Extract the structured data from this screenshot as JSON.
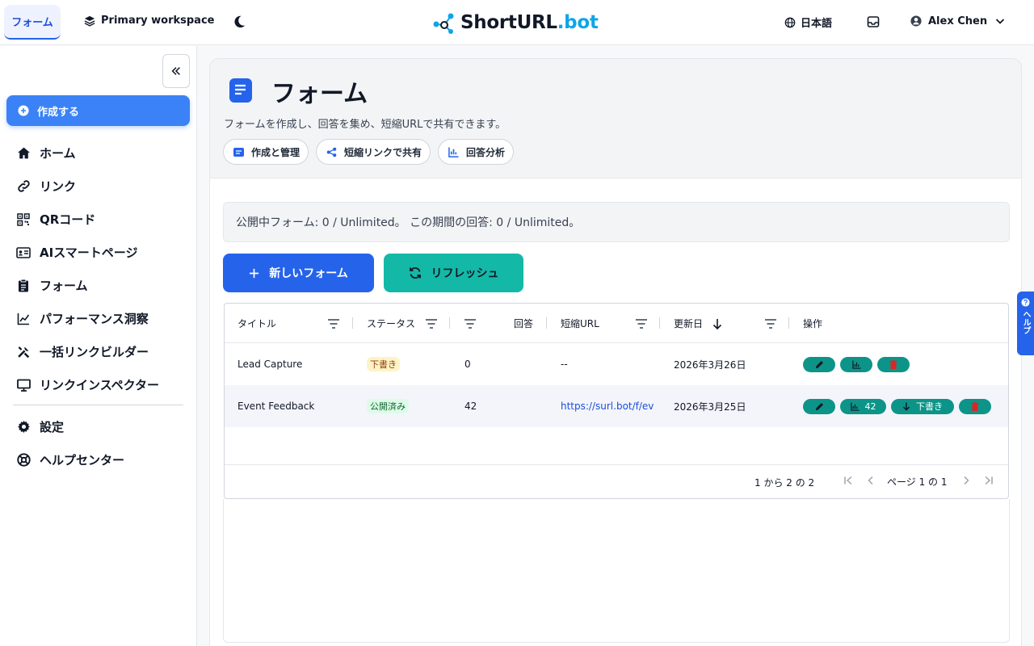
{
  "topbar": {
    "tab_label": "フォーム",
    "workspace": "Primary workspace",
    "logo_main": "ShortURL",
    "logo_suffix": ".bot",
    "language": "日本語",
    "user_name": "Alex Chen"
  },
  "sidebar": {
    "create_label": "作成する",
    "items": [
      {
        "label": "ホーム",
        "icon": "home-icon"
      },
      {
        "label": "リンク",
        "icon": "link-icon"
      },
      {
        "label": "QRコード",
        "icon": "qr-code-icon"
      },
      {
        "label": "AIスマートページ",
        "icon": "id-card-icon"
      },
      {
        "label": "フォーム",
        "icon": "clipboard-icon"
      },
      {
        "label": "パフォーマンス洞察",
        "icon": "chart-line-icon"
      },
      {
        "label": "一括リンクビルダー",
        "icon": "tools-icon"
      },
      {
        "label": "リンクインスペクター",
        "icon": "monitor-icon"
      }
    ],
    "bottom_items": [
      {
        "label": "設定",
        "icon": "gear-icon"
      },
      {
        "label": "ヘルプセンター",
        "icon": "lifebuoy-icon"
      }
    ]
  },
  "header": {
    "title": "フォーム",
    "description": "フォームを作成し、回答を集め、短縮URLで共有できます。",
    "chips": [
      {
        "label": "作成と管理",
        "icon": "form-icon"
      },
      {
        "label": "短縮リンクで共有",
        "icon": "share-icon"
      },
      {
        "label": "回答分析",
        "icon": "bar-chart-icon"
      }
    ]
  },
  "quota": "公開中フォーム: 0 / Unlimited。 この期間の回答: 0 / Unlimited。",
  "actions": {
    "new_form": "新しいフォーム",
    "refresh": "リフレッシュ"
  },
  "table": {
    "columns": [
      "タイトル",
      "ステータス",
      "回答",
      "短縮URL",
      "更新日",
      "操作"
    ],
    "rows": [
      {
        "title": "Lead Capture",
        "status": "下書き",
        "responses": "0",
        "url": "--",
        "updated": "2026年3月26日"
      },
      {
        "title": "Event Feedback",
        "status": "公開済み",
        "responses": "42",
        "url": "https://surl.bot/f/ev",
        "updated": "2026年3月25日",
        "results_count": "42",
        "unpublish_label": "下書き"
      }
    ],
    "range_text": "1 から 2 の 2",
    "page_text": "ページ 1 の 1"
  },
  "help_tab": "ヘルプ",
  "colors": {
    "primary": "#2563eb",
    "teal": "#14b8a6",
    "draft_badge": "#fef3c7",
    "published_badge": "#dcfce7"
  }
}
